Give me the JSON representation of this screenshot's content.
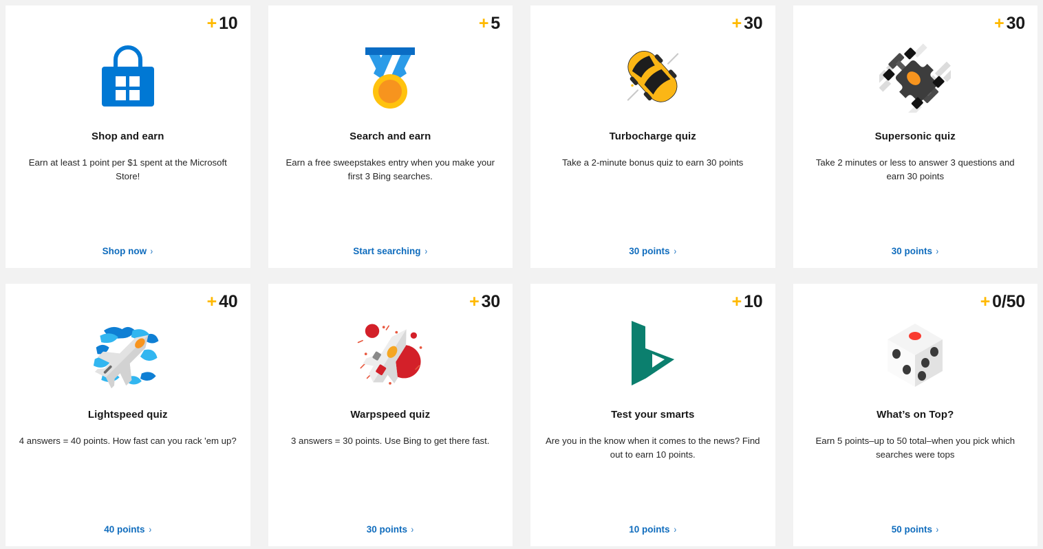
{
  "theme": {
    "page_background": "#f2f2f2",
    "card_background": "#ffffff",
    "accent_gold": "#ffb900",
    "link_blue": "#0f6cbd",
    "title_color": "#171717"
  },
  "cards": [
    {
      "id": "shop-and-earn",
      "points_plus": "+",
      "points_value": "10",
      "icon": "microsoft-store-bag-icon",
      "title": "Shop and earn",
      "description": "Earn at least 1 point per $1 spent at the Microsoft Store!",
      "link_label": "Shop now",
      "link_chevron": "›"
    },
    {
      "id": "search-and-earn",
      "points_plus": "+",
      "points_value": "5",
      "icon": "medal-icon",
      "title": "Search and earn",
      "description": "Earn a free sweepstakes entry when you make your first 3 Bing searches.",
      "link_label": "Start searching",
      "link_chevron": "›"
    },
    {
      "id": "turbocharge-quiz",
      "points_plus": "+",
      "points_value": "30",
      "icon": "yellow-sports-car-icon",
      "title": "Turbocharge quiz",
      "description": "Take a 2-minute bonus quiz to earn 30 points",
      "link_label": "30 points",
      "link_chevron": "›"
    },
    {
      "id": "supersonic-quiz",
      "points_plus": "+",
      "points_value": "30",
      "icon": "formula-race-car-icon",
      "title": "Supersonic quiz",
      "description": "Take 2 minutes or less to answer 3 questions and earn 30 points",
      "link_label": "30 points",
      "link_chevron": "›"
    },
    {
      "id": "lightspeed-quiz",
      "points_plus": "+",
      "points_value": "40",
      "icon": "jet-fighter-icon",
      "title": "Lightspeed quiz",
      "description": "4 answers = 40 points. How fast can you rack 'em up?",
      "link_label": "40 points",
      "link_chevron": "›"
    },
    {
      "id": "warpspeed-quiz",
      "points_plus": "+",
      "points_value": "30",
      "icon": "spaceship-icon",
      "title": "Warpspeed quiz",
      "description": "3 answers = 30 points. Use Bing to get there fast.",
      "link_label": "30 points",
      "link_chevron": "›"
    },
    {
      "id": "test-your-smarts",
      "points_plus": "+",
      "points_value": "10",
      "icon": "bing-logo-icon",
      "title": "Test your smarts",
      "description": "Are you in the know when it comes to the news? Find out to earn 10 points.",
      "link_label": "10 points",
      "link_chevron": "›"
    },
    {
      "id": "whats-on-top",
      "points_plus": "+",
      "points_value": "0/50",
      "icon": "dice-icon",
      "title": "What’s on Top?",
      "description": "Earn 5 points–up to 50 total–when you pick which searches were tops",
      "link_label": "50 points",
      "link_chevron": "›"
    }
  ]
}
